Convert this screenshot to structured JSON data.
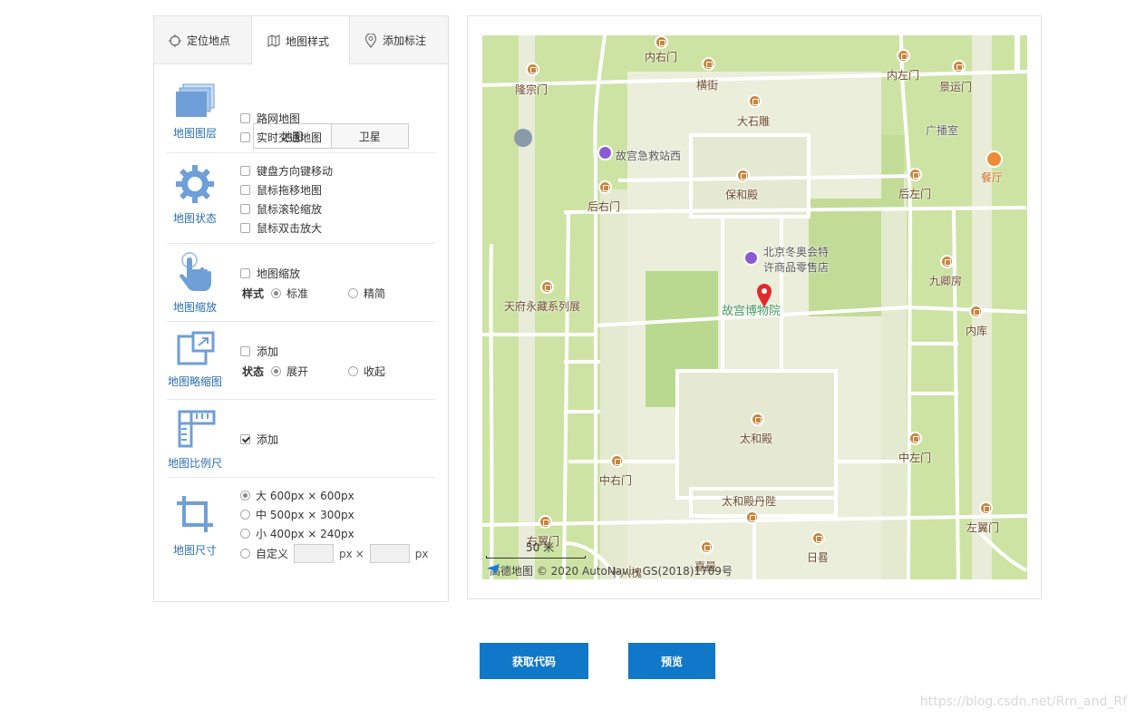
{
  "tabs": [
    {
      "label": "定位地点",
      "icon": "crosshair-icon"
    },
    {
      "label": "地图样式",
      "icon": "map-icon"
    },
    {
      "label": "添加标注",
      "icon": "location-pin-icon"
    }
  ],
  "map_type_tabs": [
    "地图",
    "卫星"
  ],
  "sections": {
    "layers": {
      "label": "地图图层",
      "options": [
        "路网地图",
        "实时交通地图"
      ]
    },
    "state": {
      "label": "地图状态",
      "options": [
        "键盘方向键移动",
        "鼠标拖移地图",
        "鼠标滚轮缩放",
        "鼠标双击放大"
      ]
    },
    "zoom": {
      "label": "地图缩放",
      "option": "地图缩放",
      "style_label": "样式",
      "style_options": [
        "标准",
        "精简"
      ]
    },
    "overview": {
      "label": "地图略缩图",
      "option": "添加",
      "state_label": "状态",
      "state_options": [
        "展开",
        "收起"
      ]
    },
    "scale": {
      "label": "地图比例尺",
      "option": "添加",
      "checked": true
    },
    "size": {
      "label": "地图尺寸",
      "options": [
        "大 600px × 600px",
        "中 500px × 300px",
        "小 400px × 240px"
      ],
      "custom_label": "自定义",
      "unit": "px",
      "times": "×"
    }
  },
  "map": {
    "pois": {
      "neiyoumen": "内右门",
      "longzongmen": "隆宗门",
      "hengjie": "横街",
      "neizuomen": "内左门",
      "jingyunmen": "景运门",
      "dashidiao": "大石雕",
      "guangboshi": "广播室",
      "jijiuzhan": "故宫急救站西",
      "canting": "餐厅",
      "houyoumen": "后右门",
      "baohedian": "保和殿",
      "houzuomen": "后左门",
      "aoyun_line1": "北京冬奥会特",
      "aoyun_line2": "许商品零售店",
      "jiuqingfang": "九卿房",
      "tianfu": "天府永藏系列展",
      "museum": "故宫博物院",
      "neiku": "内库",
      "taihedian": "太和殿",
      "zhongzuomen": "中左门",
      "zhongyoumen": "中右门",
      "danbi": "太和殿丹陛",
      "zuoyimen": "左翼门",
      "youyimen": "右翼门",
      "jialiang": "嘉量",
      "rigui": "日晷",
      "shibashu": "十八槐"
    },
    "scale_text": "50 米",
    "attribution": "高德地图 © 2020 AutoNavi - GS(2018)1709号"
  },
  "buttons": {
    "get_code": "获取代码",
    "preview": "预览"
  },
  "watermark": "https://blog.csdn.net/Rm_and_Rf",
  "colors": {
    "accent": "#0f78c8",
    "section_label": "#2a6fb0",
    "icon": "#6f9fd6",
    "map_green": "#cde3a4",
    "map_road": "#ffffff"
  }
}
